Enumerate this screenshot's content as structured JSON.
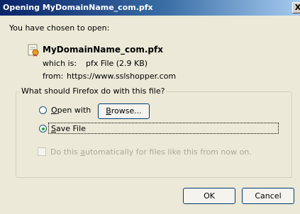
{
  "window": {
    "title": "Opening MyDomainName_com.pfx",
    "close_glyph": "X"
  },
  "intro": "You have chosen to open:",
  "file": {
    "name": "MyDomainName_com.pfx",
    "icon": "certificate-file-icon",
    "type_label": "which is:",
    "type_value": "pfx File (2.9 KB)",
    "from_label": "from:",
    "from_value": "https://www.sslshopper.com"
  },
  "action_group": {
    "legend": "What should Firefox do with this file?",
    "open_with": {
      "prefix": "",
      "accel": "O",
      "rest": "pen with",
      "selected": false
    },
    "browse": {
      "accel": "B",
      "rest": "rowse..."
    },
    "save_file": {
      "accel": "S",
      "rest": "ave File",
      "selected": true
    },
    "auto": {
      "prefix": "Do this ",
      "accel": "a",
      "rest": "utomatically for files like this from now on.",
      "checked": false,
      "enabled": false
    }
  },
  "buttons": {
    "ok": "OK",
    "cancel": "Cancel"
  },
  "colors": {
    "titlebar_start": "#0a246a",
    "titlebar_end": "#a6caf0",
    "dialog_bg": "#ece9d8",
    "radio_dot": "#21a121"
  }
}
